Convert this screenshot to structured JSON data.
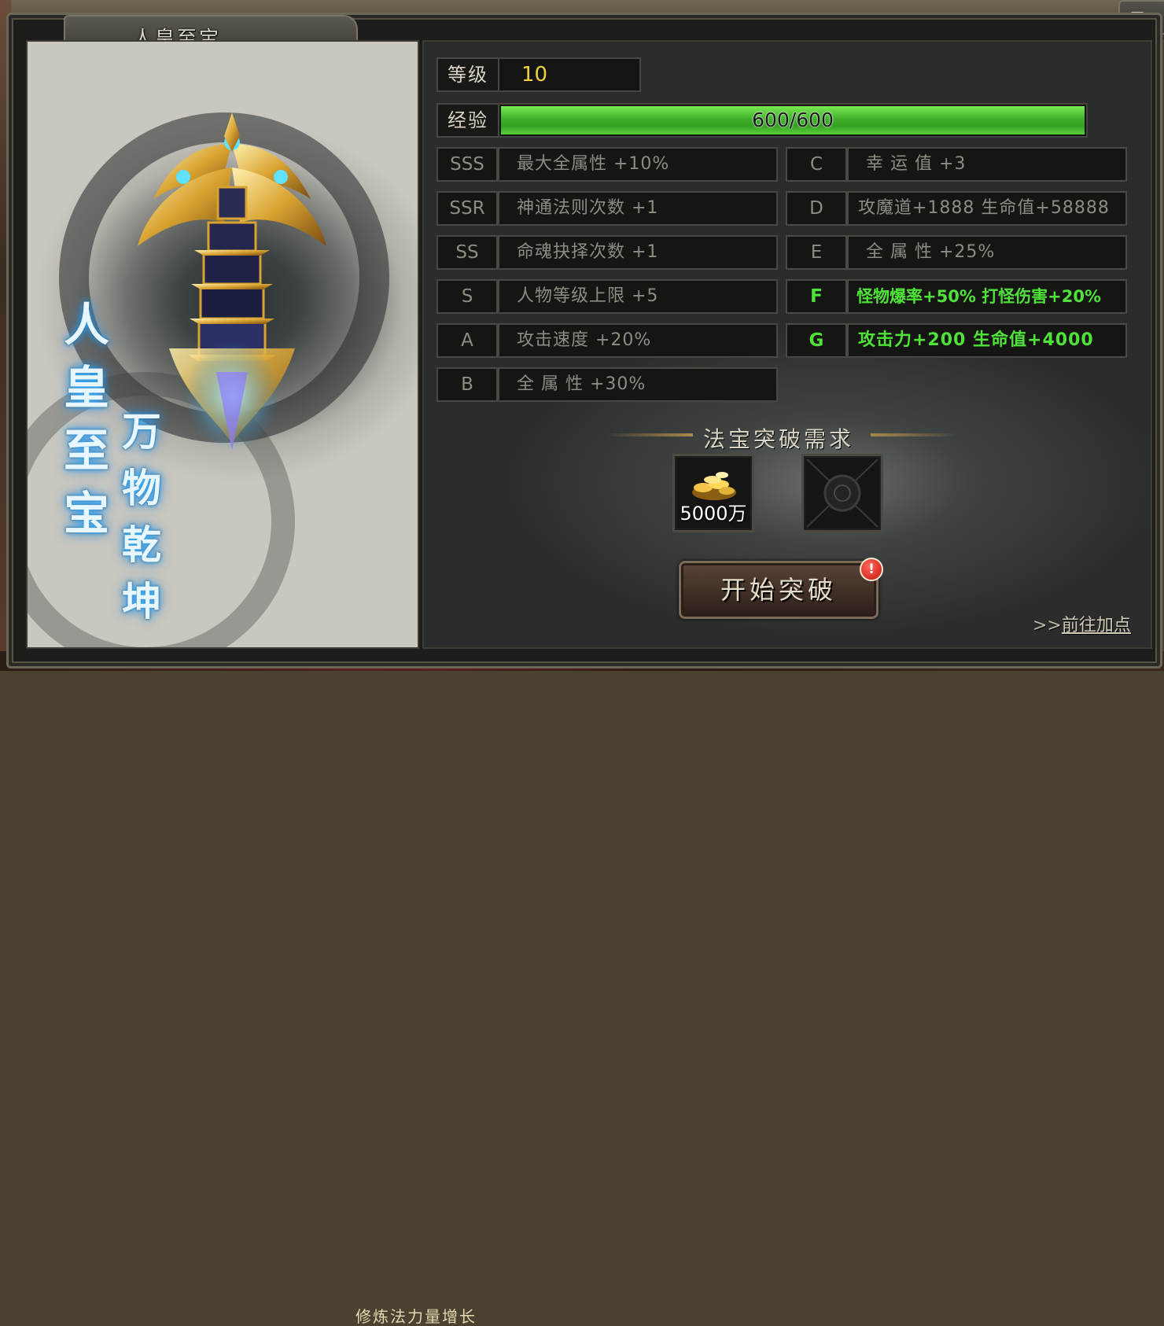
{
  "window": {
    "title": "人皇至宝",
    "corner_glyph": "≡"
  },
  "art": {
    "col1": [
      "人",
      "皇",
      "至",
      "宝"
    ],
    "col2": [
      "万",
      "物",
      "乾",
      "坤"
    ]
  },
  "stats": {
    "level_label": "等级",
    "level_value": "10",
    "exp_label": "经验",
    "exp_text": "600/600",
    "exp_fraction": 1.0
  },
  "attributes_left": [
    {
      "grade": "SSS",
      "text": "最大全属性 +10%",
      "active": false
    },
    {
      "grade": "SSR",
      "text": "神通法则次数 +1",
      "active": false
    },
    {
      "grade": "SS",
      "text": "命魂抉择次数 +1",
      "active": false
    },
    {
      "grade": "S",
      "text": "人物等级上限 +5",
      "active": false
    },
    {
      "grade": "A",
      "text": "攻击速度 +20%",
      "active": false
    },
    {
      "grade": "B",
      "text": "全 属 性 +30%",
      "active": false
    }
  ],
  "attributes_right": [
    {
      "grade": "C",
      "text": "幸 运 值 +3",
      "active": false
    },
    {
      "grade": "D",
      "text": "攻魔道+1888 生命值+58888",
      "active": false
    },
    {
      "grade": "E",
      "text": "全 属 性 +25%",
      "active": false
    },
    {
      "grade": "F",
      "text": "怪物爆率+50% 打怪伤害+20%",
      "active": true
    },
    {
      "grade": "G",
      "text": "攻击力+200 生命值+4000",
      "active": true
    }
  ],
  "requirements": {
    "title": "法宝突破需求",
    "gold_count": "5000万",
    "empty_slot": ""
  },
  "actions": {
    "start_label": "开始突破",
    "alert": "!",
    "goto_arrow": ">>",
    "goto_label": "前往加点"
  },
  "background": {
    "bottom_text": "修炼法力量增长"
  },
  "colors": {
    "active_attr": "#4fe33a",
    "level_value": "#f0d23a",
    "exp_bar": "#3fb02a"
  }
}
